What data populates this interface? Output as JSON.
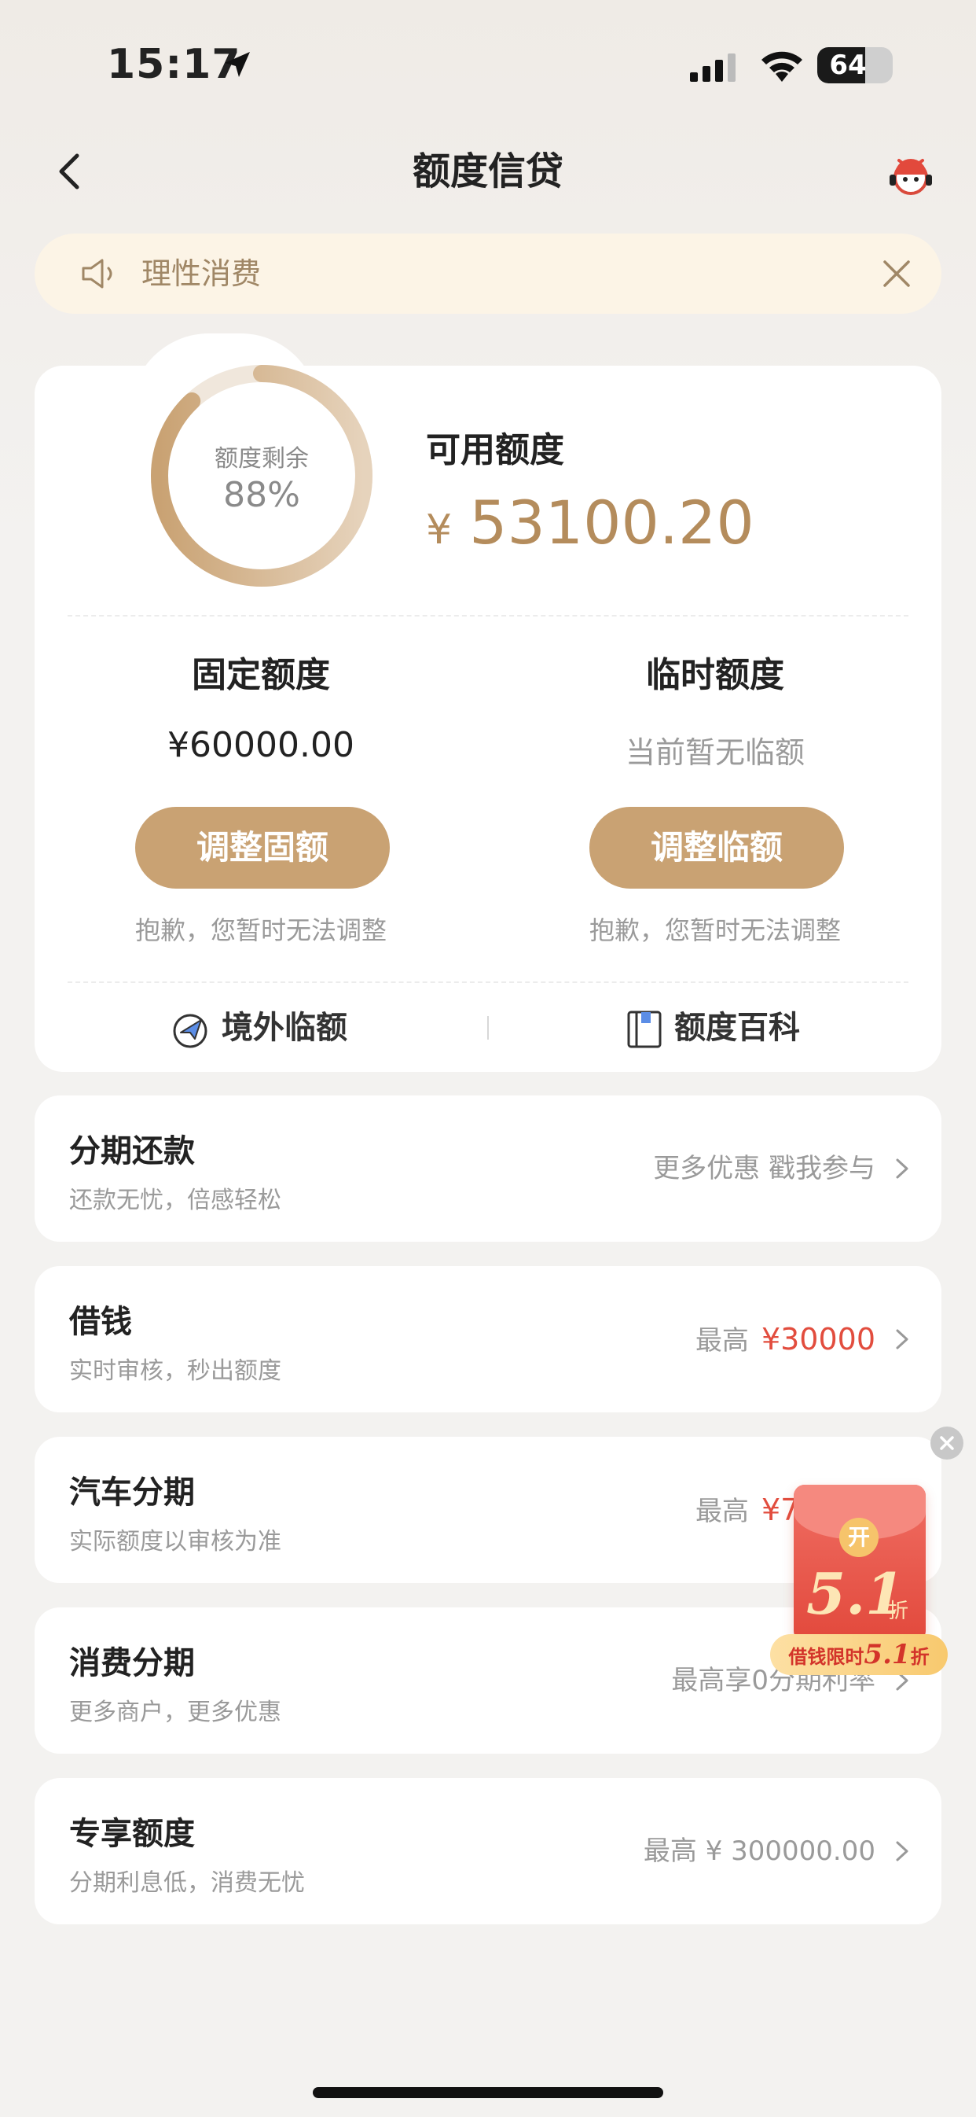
{
  "status_bar": {
    "time": "15:17",
    "battery": "64",
    "battery_level": 0.64
  },
  "nav": {
    "title": "额度信贷",
    "back_icon": "chevron-left-icon",
    "service_icon": "customer-service-icon"
  },
  "notice": {
    "text": "理性消费"
  },
  "quota": {
    "ring_label": "额度剩余",
    "ring_percent": "88%",
    "ring_fraction": 0.88,
    "available_label": "可用额度",
    "available_currency": "¥",
    "available_amount": "53100.20",
    "fixed": {
      "title": "固定额度",
      "value": "¥60000.00",
      "button": "调整固额",
      "note": "抱歉，您暂时无法调整"
    },
    "temp": {
      "title": "临时额度",
      "value": "当前暂无临额",
      "button": "调整临额",
      "note": "抱歉，您暂时无法调整"
    },
    "links": {
      "overseas": "境外临额",
      "wiki": "额度百科"
    }
  },
  "entries": [
    {
      "title": "分期还款",
      "subtitle": "还款无忧，倍感轻松",
      "right_prefix": "更多优惠 戳我参与",
      "right_amount": ""
    },
    {
      "title": "借钱",
      "subtitle": "实时审核，秒出额度",
      "right_prefix": "最高",
      "right_amount": "¥30000"
    },
    {
      "title": "汽车分期",
      "subtitle": "实际额度以审核为准",
      "right_prefix": "最高",
      "right_amount": "¥70000"
    },
    {
      "title": "消费分期",
      "subtitle": "更多商户，更多优惠",
      "right_prefix": "最高享0分期利率",
      "right_amount": ""
    },
    {
      "title": "专享额度",
      "subtitle": "分期利息低，消费无忧",
      "right_prefix": "最高 ¥ 300000.00",
      "right_amount": ""
    }
  ],
  "promo": {
    "coin": "开",
    "big": "5.1",
    "zhe": "折",
    "banner_prefix": "借钱限时",
    "banner_value": "5.1",
    "banner_suffix": "折"
  },
  "colors": {
    "accent": "#c9a273",
    "amount": "#b48c5c",
    "red": "#e24d3e"
  }
}
